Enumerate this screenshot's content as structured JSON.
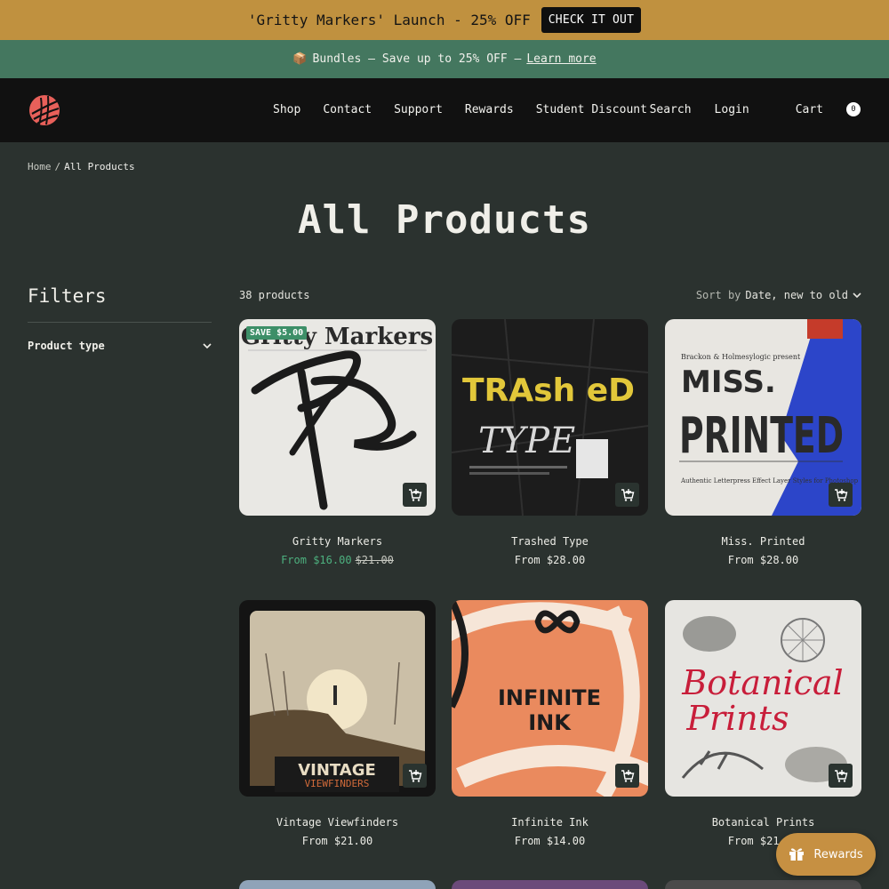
{
  "announcement": {
    "message": "'Gritty Markers' Launch - 25% OFF",
    "cta": "CHECK IT OUT"
  },
  "promo": {
    "emoji": "📦",
    "text": "Bundles – Save up to 25% OFF –",
    "link": "Learn more"
  },
  "nav": {
    "items": [
      "Shop",
      "Contact",
      "Support",
      "Rewards",
      "Student Discount"
    ],
    "search": "Search",
    "login": "Login",
    "cart": "Cart",
    "cart_count": "0"
  },
  "breadcrumb": {
    "home": "Home",
    "sep": "/",
    "current": "All Products"
  },
  "page_title": "All Products",
  "filters": {
    "title": "Filters",
    "product_type": "Product type"
  },
  "listing": {
    "count": "38 products",
    "sort_label": "Sort by",
    "sort_value": "Date, new to old"
  },
  "products": [
    {
      "name": "Gritty Markers",
      "price": "From $16.00",
      "compare": "$21.00",
      "badge": "SAVE $5.00",
      "art_title": "Gritty Markers"
    },
    {
      "name": "Trashed Type",
      "price": "From $28.00",
      "art_line1": "TRAsh eD",
      "art_line2": "TYPE"
    },
    {
      "name": "Miss. Printed",
      "price": "From $28.00",
      "art_top": "Brackon & Holmesylogic present",
      "art_line1": "MISS.",
      "art_line2": "PRINTED",
      "art_sub": "Authentic Letterpress Effect Layer Styles for Photoshop"
    },
    {
      "name": "Vintage Viewfinders",
      "price": "From $21.00",
      "art_line1": "VINTAGE",
      "art_line2": "VIEWFINDERS"
    },
    {
      "name": "Infinite Ink",
      "price": "From $14.00",
      "art_line1": "INFINITE",
      "art_line2": "INK"
    },
    {
      "name": "Botanical Prints",
      "price": "From $21.00",
      "art_line1": "Botanical",
      "art_line2": "Prints"
    }
  ],
  "rewards_widget": {
    "label": "Rewards"
  },
  "colors": {
    "background": "#2b322f",
    "announcement": "#c0913f",
    "promo": "#44775f",
    "nav": "#111111",
    "sale": "#4db17f",
    "rewards": "#c69042"
  }
}
